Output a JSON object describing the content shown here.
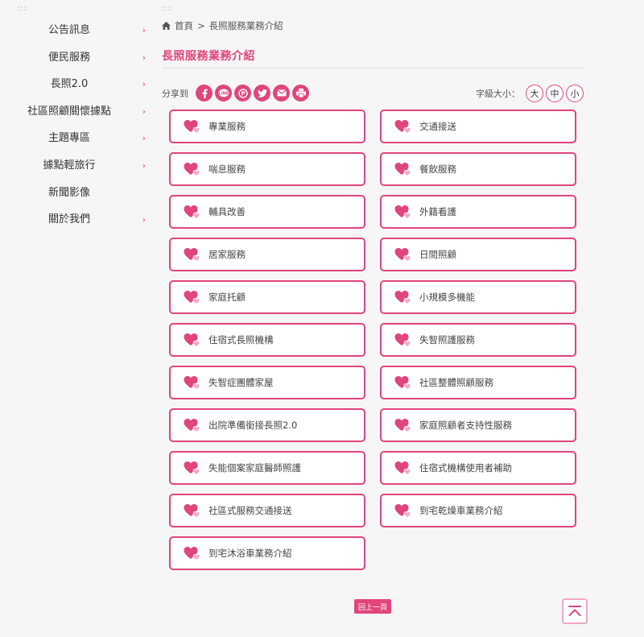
{
  "colors": {
    "accent": "#e0457b",
    "accent_light": "#f2a7c1",
    "background": "#f6f6f6"
  },
  "decor": {
    "dots": ":::"
  },
  "sidebar": {
    "items": [
      {
        "label": "公告訊息",
        "has_arrow": true
      },
      {
        "label": "便民服務",
        "has_arrow": true
      },
      {
        "label": "長照2.0",
        "has_arrow": true
      },
      {
        "label": "社區照顧關懷據點",
        "has_arrow": true
      },
      {
        "label": "主題專區",
        "has_arrow": true
      },
      {
        "label": "據點輕旅行",
        "has_arrow": true
      },
      {
        "label": "新聞影像",
        "has_arrow": false
      },
      {
        "label": "關於我們",
        "has_arrow": true
      }
    ],
    "arrow_glyph": "›"
  },
  "breadcrumb": {
    "home_icon": "home-icon",
    "home": "首頁",
    "separator": ">",
    "current": "長照服務業務介紹"
  },
  "page_title": "長照服務業務介紹",
  "share": {
    "label": "分享到",
    "buttons": [
      "facebook-icon",
      "line-icon",
      "plurk-icon",
      "twitter-icon",
      "email-icon",
      "print-icon"
    ]
  },
  "font_size": {
    "label": "字級大小：",
    "large": "大",
    "medium": "中",
    "small": "小"
  },
  "services": [
    "專業服務",
    "交通接送",
    "喘息服務",
    "餐飲服務",
    "輔具改善",
    "外籍看護",
    "居家服務",
    "日間照顧",
    "家庭托顧",
    "小規模多機能",
    "住宿式長照機構",
    "失智照護服務",
    "失智症團體家屋",
    "社區整體照顧服務",
    "出院準備銜接長照2.0",
    "家庭照顧者支持性服務",
    "失能個案家庭醫師照護",
    "住宿式機構使用者補助",
    "社區式服務交通接送",
    "到宅乾燥車業務介紹",
    "到宅沐浴車業務介紹"
  ],
  "service_icon": "heart-icon",
  "back_button": "回上一頁",
  "top_button_icon": "back-to-top-icon"
}
